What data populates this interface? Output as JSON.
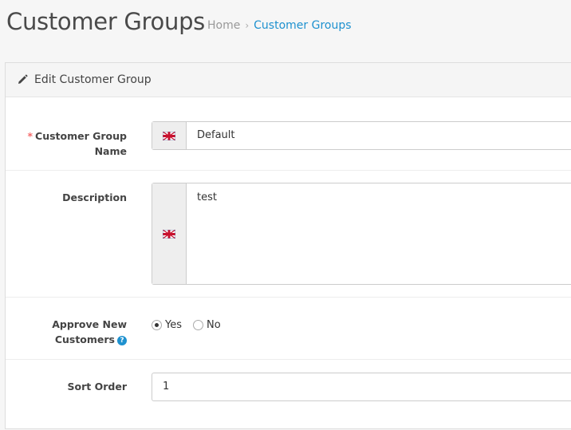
{
  "header": {
    "title": "Customer Groups",
    "breadcrumb": [
      {
        "label": "Home"
      },
      {
        "label": "Customer Groups"
      }
    ],
    "breadcrumb_separator": "›"
  },
  "panel": {
    "heading": "Edit Customer Group",
    "heading_icon": "pencil-icon"
  },
  "form": {
    "group_name": {
      "required_mark": "*",
      "label_line1": "Customer Group",
      "label_line2": "Name",
      "value": "Default",
      "language_icon": "uk-flag-icon"
    },
    "description": {
      "label": "Description",
      "value": "test",
      "language_icon": "uk-flag-icon"
    },
    "approve": {
      "label_line1": "Approve New",
      "label_line2": "Customers",
      "help_icon": "question-circle-icon",
      "help_glyph": "?",
      "options": [
        {
          "label": "Yes",
          "checked": true
        },
        {
          "label": "No",
          "checked": false
        }
      ]
    },
    "sort_order": {
      "label": "Sort Order",
      "value": "1"
    }
  },
  "colors": {
    "link": "#1e91cf",
    "required": "#f56b6b",
    "addon_bg": "#eeeeee"
  }
}
